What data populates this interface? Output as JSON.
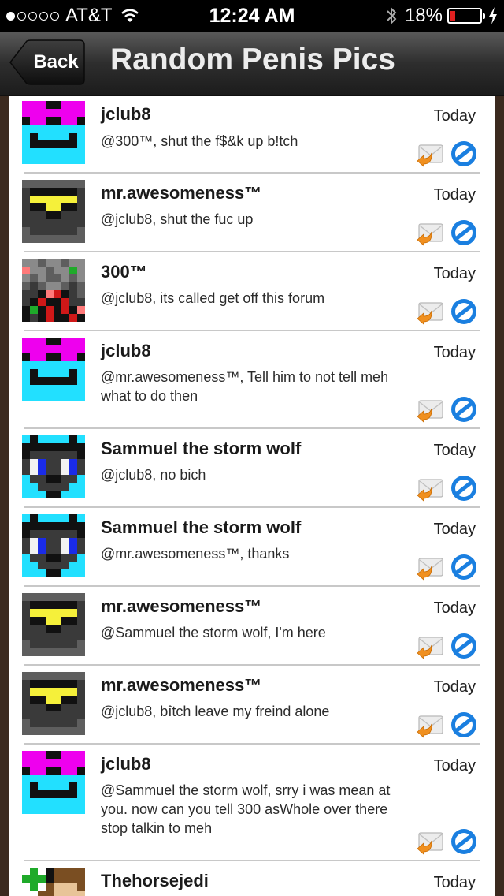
{
  "status_bar": {
    "carrier": "AT&T",
    "time": "12:24 AM",
    "battery": "18%",
    "battery_level": 0.18,
    "signal_bars": 1
  },
  "nav": {
    "back_label": "Back",
    "title": "Random Penis Pics"
  },
  "posts": [
    {
      "author": "jclub8",
      "date": "Today",
      "message": "@300™, shut the f$&k up b!tch",
      "avatar": "pink-glasses"
    },
    {
      "author": "mr.awesomeness™",
      "date": "Today",
      "message": "@jclub8, shut the fuc up",
      "avatar": "dark-yellow"
    },
    {
      "author": "300™",
      "date": "Today",
      "message": "@jclub8, its called get off this forum",
      "avatar": "gray-pixel"
    },
    {
      "author": "jclub8",
      "date": "Today",
      "message": "@mr.awesomeness™, Tell him to not tell meh what to do then",
      "avatar": "pink-glasses"
    },
    {
      "author": "Sammuel the storm wolf",
      "date": "Today",
      "message": "@jclub8, no bich",
      "avatar": "wolf"
    },
    {
      "author": "Sammuel the storm wolf",
      "date": "Today",
      "message": "@mr.awesomeness™, thanks",
      "avatar": "wolf"
    },
    {
      "author": "mr.awesomeness™",
      "date": "Today",
      "message": "@Sammuel the storm wolf, I'm here",
      "avatar": "dark-yellow"
    },
    {
      "author": "mr.awesomeness™",
      "date": "Today",
      "message": "@jclub8, bîtch leave my freind alone",
      "avatar": "dark-yellow"
    },
    {
      "author": "jclub8",
      "date": "Today",
      "message": "@Sammuel the storm wolf, srry i was mean at you. now can you tell 300 asWhole over there stop talkin to meh",
      "avatar": "pink-glasses"
    },
    {
      "author": "Thehorsejedi",
      "date": "Today",
      "message": "",
      "avatar": "horse"
    }
  ],
  "icons": {
    "reply": "reply-mail-icon",
    "block": "block-icon"
  },
  "colors": {
    "accent_blue": "#1a7fe0",
    "reply_orange": "#f09020",
    "background_brown": "#3b2a1f"
  }
}
